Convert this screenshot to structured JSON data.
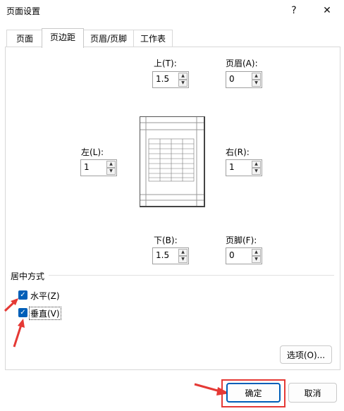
{
  "window": {
    "title": "页面设置",
    "help": "?",
    "close": "✕"
  },
  "tabs": [
    {
      "label": "页面",
      "active": false
    },
    {
      "label": "页边距",
      "active": true
    },
    {
      "label": "页眉/页脚",
      "active": false
    },
    {
      "label": "工作表",
      "active": false
    }
  ],
  "margins": {
    "top": {
      "label": "上(T):",
      "value": "1.5"
    },
    "header": {
      "label": "页眉(A):",
      "value": "0"
    },
    "left": {
      "label": "左(L):",
      "value": "1"
    },
    "right": {
      "label": "右(R):",
      "value": "1"
    },
    "bottom": {
      "label": "下(B):",
      "value": "1.5"
    },
    "footer": {
      "label": "页脚(F):",
      "value": "0"
    }
  },
  "center": {
    "section_label": "居中方式",
    "horizontal": {
      "label": "水平(Z)",
      "checked": true
    },
    "vertical": {
      "label": "垂直(V)",
      "checked": true
    }
  },
  "buttons": {
    "options": "选项(O)...",
    "ok": "确定",
    "cancel": "取消"
  },
  "colors": {
    "accent": "#005fb8",
    "annotation": "#e53935"
  }
}
